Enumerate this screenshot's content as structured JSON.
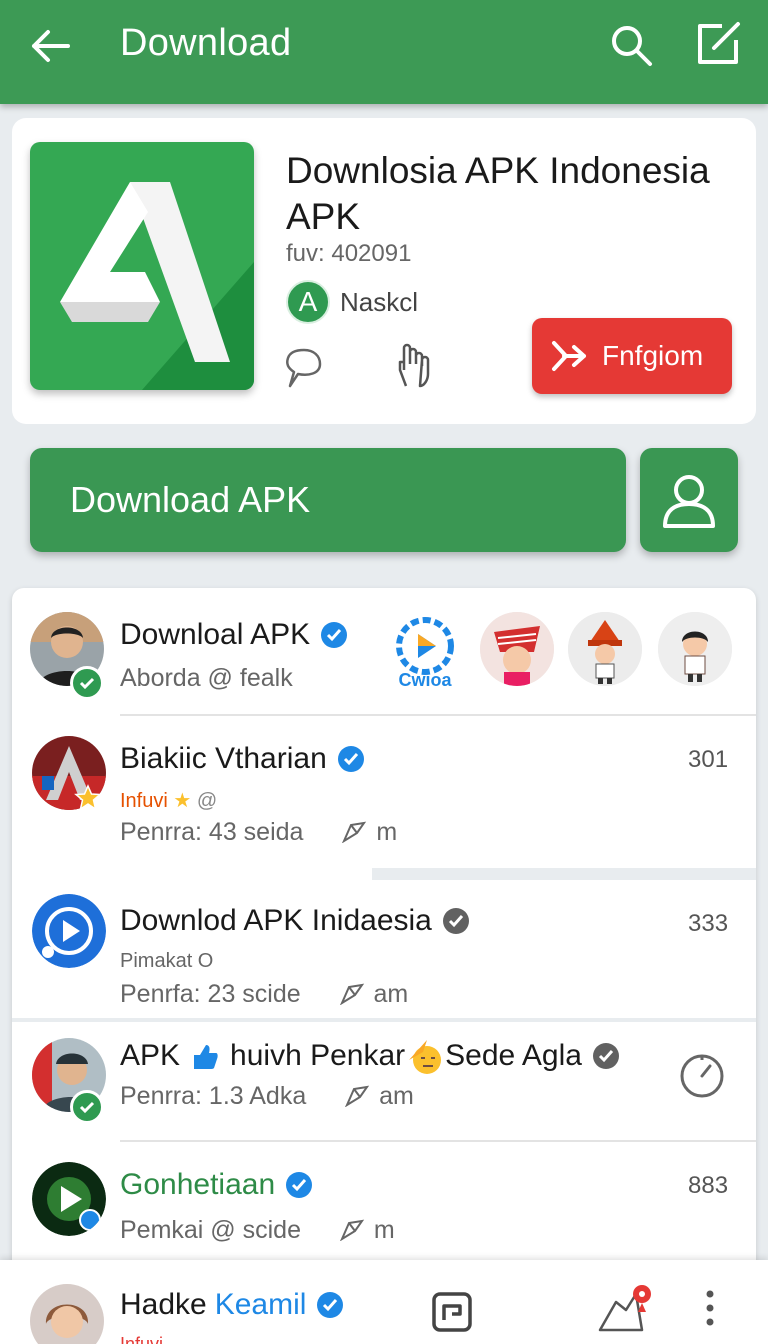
{
  "appbar": {
    "title": "Download",
    "back_icon": "arrow-left-icon",
    "search_icon": "search-icon",
    "edit_icon": "edit-icon",
    "color": "#3d9a55"
  },
  "app": {
    "title": "Downlosia APK Indonesia APK",
    "version": "fuv: 402091",
    "developer_badge": "A",
    "developer": "Naskcl",
    "follow_label": "Fnfgiom",
    "follow_color": "#e53935"
  },
  "actions": {
    "download_label": "Download APK",
    "user_icon": "user-icon"
  },
  "list": {
    "items": [
      {
        "name": "Downloal APK",
        "sub": "Aborda @  fealk",
        "story_label": "Cwioa"
      },
      {
        "name": "Biakiic Vtharian",
        "tag": "Infuvi",
        "meta_left": "Penrra: 43 seida",
        "meta_right": "m",
        "count": "301"
      },
      {
        "name": "Downlod APK Inidaesia",
        "tag": "Pimakat O",
        "meta_left": "Penrfa: 23 scide",
        "meta_right": "am",
        "count": "333"
      },
      {
        "name_a": "APK",
        "name_b": "huivh Penkar",
        "name_c": "Sede Agla",
        "meta_left": "Penrra: 1.3 Adka",
        "meta_right": "am"
      },
      {
        "name": "Gonhetiaan",
        "meta_left": "Pemkai @  scide",
        "meta_right": "m",
        "count": "883"
      }
    ]
  },
  "bottom": {
    "name": "Hadke",
    "name_highlight": "Keamil",
    "sub": "Infuvi"
  }
}
